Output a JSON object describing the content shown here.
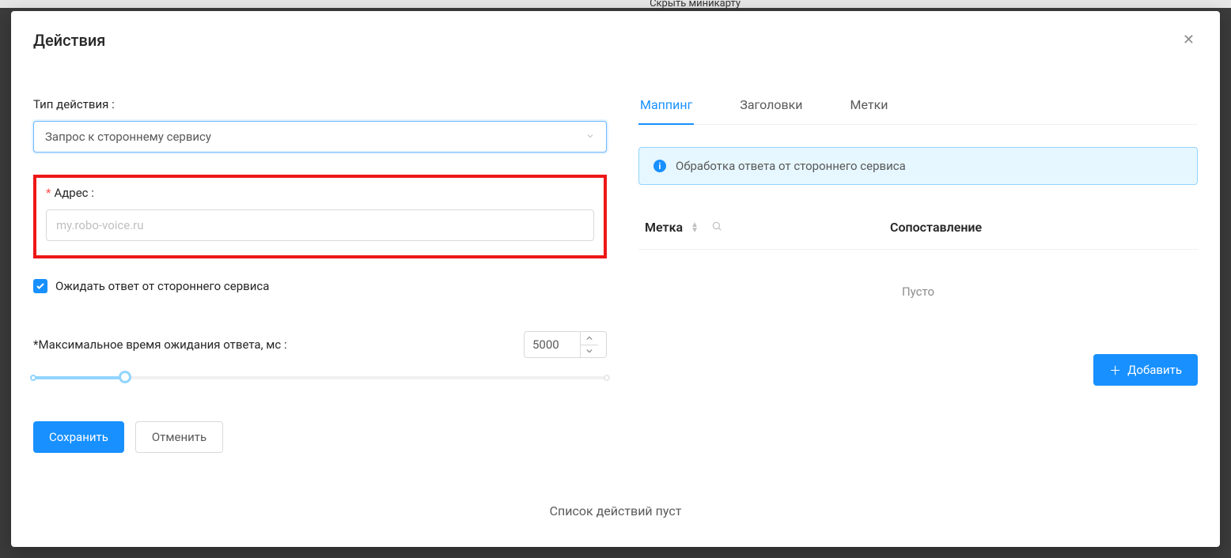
{
  "backdrop": {
    "minimap_hint": "Скрыть миникарту"
  },
  "modal": {
    "title": "Действия",
    "close_label": "✕"
  },
  "left": {
    "action_type_label": "Тип действия :",
    "action_type_value": "Запрос к стороннему сервису",
    "address_label": "Адрес :",
    "address_placeholder": "my.robo-voice.ru",
    "wait_checkbox_label": "Ожидать ответ от стороннего сервиса",
    "wait_checked": true,
    "timeout_label": "Максимальное время ожидания ответа, мс :",
    "timeout_value": "5000",
    "slider_percent": 16,
    "save_label": "Сохранить",
    "cancel_label": "Отменить"
  },
  "right": {
    "tabs": [
      {
        "label": "Маппинг",
        "active": true
      },
      {
        "label": "Заголовки",
        "active": false
      },
      {
        "label": "Метки",
        "active": false
      }
    ],
    "alert_text": "Обработка ответа от стороннего сервиса",
    "table": {
      "col_label": "Метка",
      "col_match": "Сопоставление",
      "empty_text": "Пусто"
    },
    "add_label": "Добавить"
  },
  "footer": {
    "empty_list": "Список действий пуст"
  }
}
